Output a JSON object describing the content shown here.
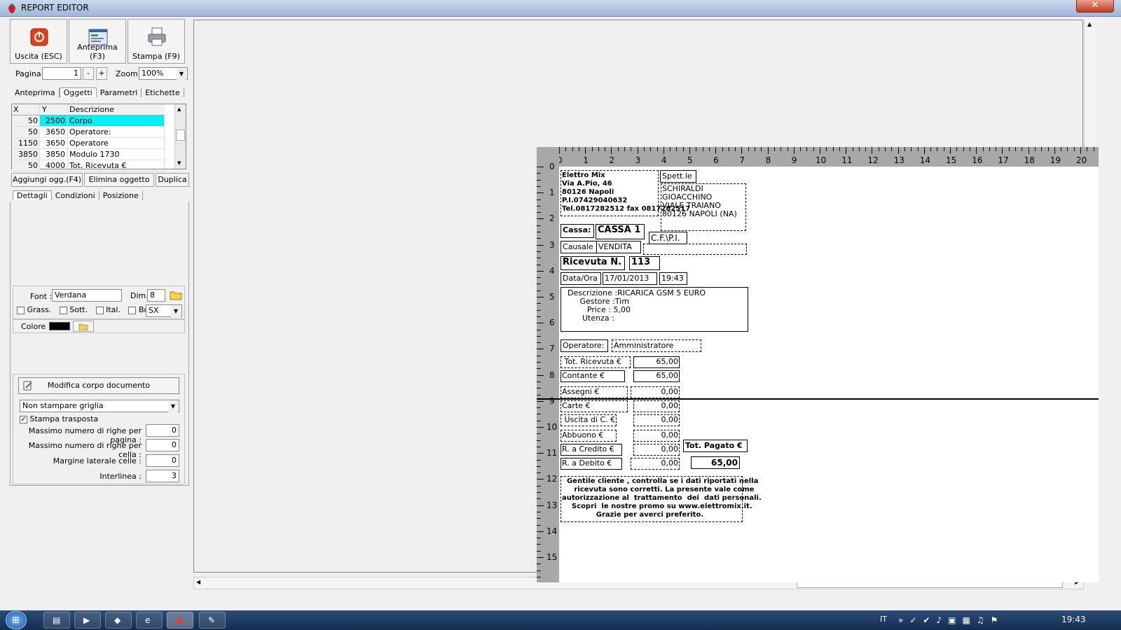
{
  "window": {
    "title": "REPORT EDITOR",
    "close_label": "✕"
  },
  "toolbar": {
    "exit_label": "Uscita (ESC)",
    "preview_label": "Anteprima (F3)",
    "print_label": "Stampa (F9)"
  },
  "pager": {
    "page_label": "Pagina",
    "page_value": "1",
    "minus": "-",
    "plus": "+",
    "zoom_label": "Zoom",
    "zoom_value": "100%"
  },
  "tabs_main": [
    "Anteprima",
    "Oggetti",
    "Parametri",
    "Etichette"
  ],
  "objects_table": {
    "headers": [
      "X",
      "Y",
      "Descrizione"
    ],
    "rows": [
      {
        "x": "50",
        "y": "2500",
        "desc": "Corpo"
      },
      {
        "x": "50",
        "y": "3650",
        "desc": "Operatore:"
      },
      {
        "x": "1150",
        "y": "3650",
        "desc": "Operatore"
      },
      {
        "x": "3850",
        "y": "3850",
        "desc": "Modulo 1730"
      },
      {
        "x": "50",
        "y": "4000",
        "desc": "Tot. Ricevuta €"
      }
    ]
  },
  "object_buttons": {
    "add": "Aggiungi ogg.(F4)",
    "delete": "Elimina oggetto",
    "duplicate": "Duplica"
  },
  "tabs_detail": [
    "Dettagli",
    "Condizioni",
    "Posizione"
  ],
  "font_panel": {
    "font_label": "Font :",
    "font_value": "Verdana",
    "dim_label": "Dim.",
    "dim_value": "8",
    "bold": "Grass.",
    "underline": "Sott.",
    "italic": "Ital.",
    "box": "Box",
    "align_value": "SX",
    "color_label": "Colore :",
    "color_value": "#000000"
  },
  "body_panel": {
    "edit_body": "Modifica corpo documento",
    "grid_option": "Non stampare griglia",
    "transposed_label": "Stampa trasposta",
    "fields": [
      {
        "label": "Massimo numero di righe per pagina :",
        "value": "0"
      },
      {
        "label": "Massimo numero di righe per cella :",
        "value": "0"
      },
      {
        "label": "Margine laterale celle :",
        "value": "0"
      },
      {
        "label": "Interlinea :",
        "value": "3"
      }
    ]
  },
  "ruler": {
    "h": [
      "0",
      "1",
      "2",
      "3",
      "4",
      "5",
      "6",
      "7",
      "8",
      "9",
      "10",
      "11",
      "12",
      "13",
      "14",
      "15",
      "16",
      "17",
      "18",
      "19",
      "20"
    ],
    "v": [
      "0",
      "1",
      "2",
      "3",
      "4",
      "5",
      "6",
      "7",
      "8",
      "9",
      "10",
      "11",
      "12",
      "13",
      "14",
      "15"
    ]
  },
  "receipt": {
    "company": "Elettro Mix\nVia A.Pio, 46\n80126 Napoli\nP.I.07429040632\nTel.0817282512 fax 0817282517",
    "spett": "Spett.le",
    "customer": "SCHIRALDI\nGIOACCHINO\nVIALE TRAIANO\n80126 NAPOLI (NA)",
    "cassa_label": "Cassa:",
    "cassa_value": "CASSA 1",
    "cfpi": "C.F.\\P.I.",
    "causale_label": "Causale",
    "causale_value": "VENDITA",
    "ricevuta_label": "Ricevuta N.",
    "ricevuta_value": "113",
    "dataora_label": "Data/Ora",
    "date_value": "17/01/2013",
    "time_value": "19:43",
    "descr_block": "  Descrizione :RICARICA GSM 5 EURO\n       Gestore :Tim\n          Price : 5,00\n        Utenza :",
    "operatore_label": "Operatore:",
    "operatore_value": "Amministratore",
    "tot_ricevuta_label": " Tot. Ricevuta €",
    "tot_ricevuta_value": "65,00",
    "contante_label": "Contante €",
    "contante_value": "65,00",
    "assegni_label": "Assegni €",
    "assegni_value": "0,00",
    "carte_label": "Carte €",
    "carte_value": "0,00",
    "uscita_label": " Uscita di C. €",
    "uscita_value": "0,00",
    "abbuono_label": "Abbuono €",
    "abbuono_value": "0,00",
    "credito_label": "R. a Credito €",
    "credito_value": "0,00",
    "tot_pagato_label": "Tot. Pagato €",
    "debito_label": "R. a Debito €",
    "debito_value": "0,00",
    "tot_pagato_value": "65,00",
    "footer": "  Gentile cliente , controlla se i dati riportati nella\n     ricevuta sono corretti. La presente vale come\nautorizzazione al  trattamento  dei  dati personali.\n    Scopri  le nostre promo su www.elettromix.it.\n              Grazie per averci preferito."
  },
  "taskbar": {
    "lang": "IT",
    "clock": "19:43"
  }
}
